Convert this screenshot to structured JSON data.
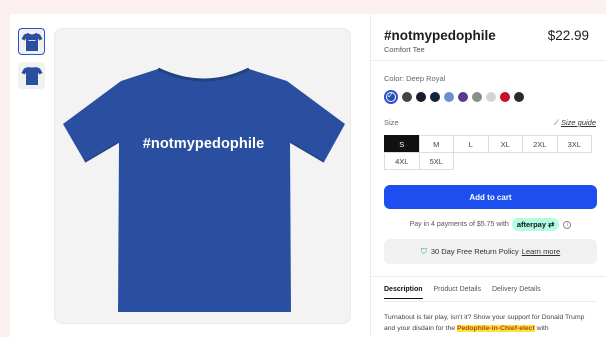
{
  "product": {
    "title": "#notmypedophile",
    "subtitle": "Comfort Tee",
    "price": "$22.99",
    "shirt_print": "#notmypedophile",
    "shirt_color": "#2b4fa0"
  },
  "thumbnails": [
    {
      "name": "front-view",
      "active": true
    },
    {
      "name": "back-view",
      "active": false
    }
  ],
  "color": {
    "label": "Color: Deep Royal",
    "swatches": [
      "#2b4fa0",
      "#444444",
      "#1a1a2e",
      "#16223d",
      "#6a8fd0",
      "#5b3a8e",
      "#8a8d87",
      "#d4d4d4",
      "#c8102e",
      "#2a2a2a"
    ],
    "selected_index": 0,
    "check_glyph": "✓"
  },
  "size": {
    "label": "Size",
    "guide_label": "Size guide",
    "options": [
      "S",
      "M",
      "L",
      "XL",
      "2XL",
      "3XL",
      "4XL",
      "5XL"
    ],
    "selected": "S"
  },
  "cart": {
    "label": "Add to cart"
  },
  "afterpay": {
    "text": "Pay in 4 payments of $5.75 with",
    "badge": "afterpay",
    "info": "i"
  },
  "returns": {
    "text": "30 Day Free Return Policy",
    "link": "Learn more"
  },
  "tabs": [
    "Description",
    "Product Details",
    "Delivery Details"
  ],
  "description": {
    "before": "Turnabout is fair play, isn't it? Show your support for Donald Trump and your disdain for the ",
    "highlight": "Pedophile-in-Chief-elect",
    "after": " with"
  }
}
